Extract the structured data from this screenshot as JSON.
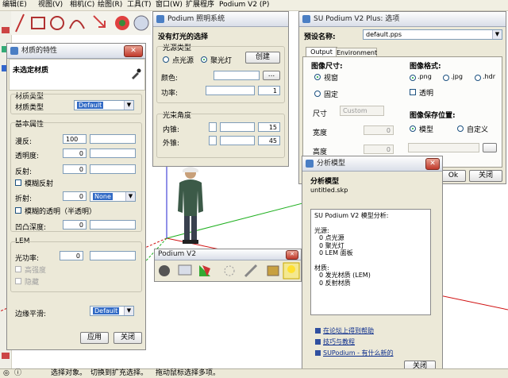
{
  "menubar": {
    "items": [
      "编辑(E)",
      "视图(V)",
      "相机(C)",
      "绘图(R)",
      "工具(T)",
      "窗口(W)",
      "扩展程序",
      "Podium V2 (P)"
    ]
  },
  "status": {
    "items": [
      "选择对象。",
      "切换到扩充选择。",
      "拖动鼠标选择多项。"
    ]
  },
  "material_panel": {
    "title": "材质的特性",
    "name": "未选定材质",
    "type_group": "材质类型",
    "type_label": "材质类型",
    "type_value": "Default",
    "basic_group": "基本属性",
    "diffuse_label": "漫反:",
    "diffuse_value": "100",
    "transparency_label": "透明度:",
    "transparency_value": "0",
    "reflection_label": "反射:",
    "reflection_value": "0",
    "blur_reflection_label": "模糊反射",
    "refraction_label": "折射:",
    "refraction_value": "0",
    "refraction_select": "None",
    "blur_transparency_label": "模糊的透明（半透明）",
    "depth_label": "凹凸深度:",
    "depth_value": "0",
    "lem_group": "LEM",
    "lem_power_label": "光功率:",
    "lem_power_value": "0",
    "lem_bright_label": "高强度",
    "lem_hide_label": "隐藏",
    "smooth_label": "边缘平滑:",
    "smooth_value": "Default",
    "apply_label": "应用",
    "close_label": "关闭"
  },
  "lighting_panel": {
    "title": "Podium 照明系统",
    "heading": "没有灯光的选择",
    "type_group": "光源类型",
    "point_label": "点光源",
    "spot_label": "聚光灯",
    "create_label": "创建",
    "color_label": "颜色:",
    "color_btn": "...",
    "power_label": "功率:",
    "power_value": "1",
    "angle_group": "光束角度",
    "inner_label": "内锥:",
    "inner_value": "15",
    "outer_label": "外锥:",
    "outer_value": "45"
  },
  "podium_toolbar": {
    "title": "Podium V2"
  },
  "options_panel": {
    "title": "SU Podium V2 Plus: 选项",
    "preset_label": "预设名称:",
    "preset_value": "default.pps",
    "tab_output": "Output",
    "tab_environment": "Environment",
    "size_label": "图像尺寸:",
    "viewport_label": "视窗",
    "fixed_label": "固定",
    "dim_label": "尺寸",
    "dim_value": "Custom",
    "width_label": "宽度",
    "width_value": "0",
    "height_label": "高度",
    "height_value": "0",
    "format_label": "图像格式:",
    "png_label": ".png",
    "jpg_label": ".jpg",
    "hdr_label": ".hdr",
    "transparent_label": "透明",
    "save_label": "图像保存位置:",
    "model_label": "模型",
    "custom_label": "自定义",
    "ok_label": "Ok",
    "close_label": "关闭"
  },
  "analysis_panel": {
    "title": "分析模型",
    "heading": "分析模型",
    "filename": "untitled.skp",
    "report_lines": [
      "SU Podium V2 模型分析:",
      "",
      "光源:",
      "  0 点光源",
      "  0 聚光灯",
      "  0 LEM 面板",
      "",
      "材质:",
      "  0 发光材质 (LEM)",
      "  0 反射材质"
    ],
    "link_forum": "在论坛上得到帮助",
    "link_tips": "技巧与教程",
    "link_news": "SUPodium - 有什么新的",
    "close_label": "关闭"
  },
  "colors": {
    "axis_red": "#d01010",
    "axis_green": "#20b020",
    "axis_blue": "#2020d0",
    "dialog_bg": "#ece9d8"
  }
}
